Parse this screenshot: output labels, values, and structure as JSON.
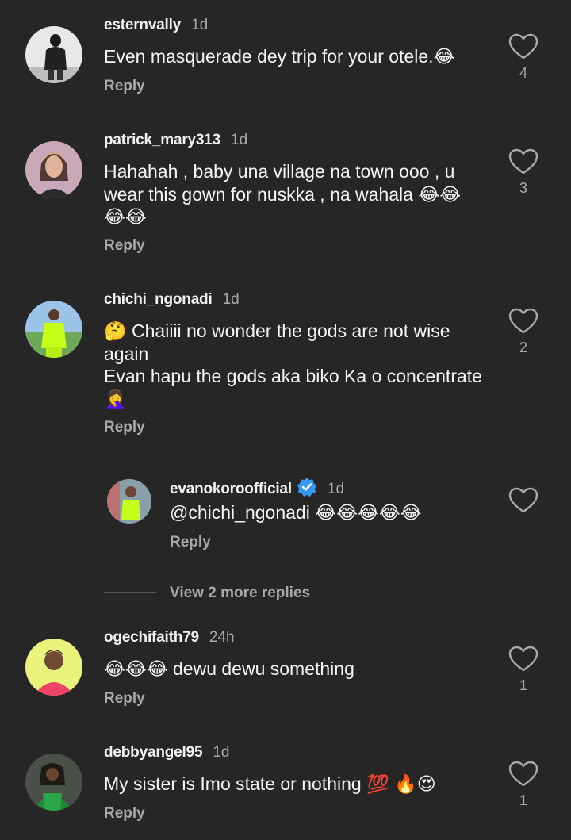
{
  "comments": [
    {
      "username": "esternvally",
      "time": "1d",
      "text": "Even masquerade dey trip for your otele.😂",
      "reply_label": "Reply",
      "likes": "4"
    },
    {
      "username": "patrick_mary313",
      "time": "1d",
      "text": "Hahahah , baby una village na town ooo , u wear this gown for nuskka , na wahala 😂😂\n😂😂",
      "reply_label": "Reply",
      "likes": "3"
    },
    {
      "username": "chichi_ngonadi",
      "time": "1d",
      "text": "🤔 Chaiiii no wonder the gods are not  wise again\nEvan hapu the gods aka biko Ka o concentrate 🤦‍♀️",
      "reply_label": "Reply",
      "likes": "2"
    },
    {
      "username": "ogechifaith79",
      "time": "24h",
      "text": "😂😂😂 dewu dewu something",
      "reply_label": "Reply",
      "likes": "1"
    },
    {
      "username": "debbyangel95",
      "time": "1d",
      "text": "My sister is Imo state or nothing 💯 🔥😍",
      "reply_label": "Reply",
      "likes": "1"
    }
  ],
  "reply": {
    "username": "evanokoroofficial",
    "time": "1d",
    "text": "@chichi_ngonadi 😂😂😂😂😂",
    "reply_label": "Reply"
  },
  "view_more_replies": "View 2 more replies",
  "colors": {
    "background": "#262626",
    "secondary_text": "#a8a8a8",
    "verified": "#3897f0"
  },
  "icons": {
    "like": "heart-outline-icon",
    "verified": "verified-badge-icon"
  }
}
